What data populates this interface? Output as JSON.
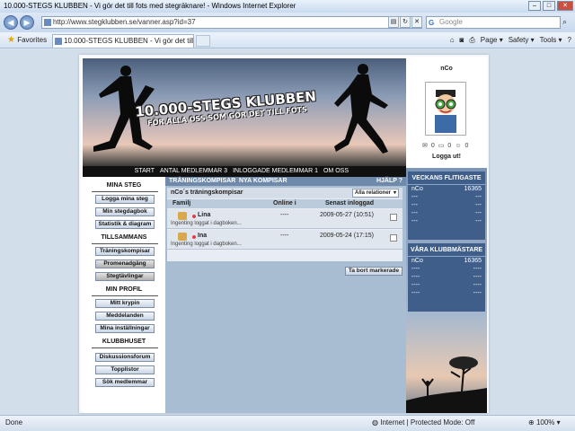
{
  "browser": {
    "title": "10.000-STEGS KLUBBEN - Vi gör det till fots med stegräknare! - Windows Internet Explorer",
    "url": "http://www.stegklubben.se/vanner.asp?id=37",
    "search_placeholder": "Google",
    "favorites_label": "Favorites",
    "tab_title": "10.000-STEGS KLUBBEN - Vi gör det till fots med s...",
    "cmd": {
      "page": "Page ▾",
      "safety": "Safety ▾",
      "tools": "Tools ▾",
      "help": "?"
    },
    "status_done": "Done",
    "status_zone": "Internet | Protected Mode: Off",
    "zoom": "100%"
  },
  "banner": {
    "title": "10.000-STEGS KLUBBEN",
    "subtitle": "FÖR ALLA OSS SOM GÖR DET TILL FOTS"
  },
  "topnav": {
    "start": "START",
    "members": "ANTAL MEDLEMMAR 3",
    "logged": "INLOGGADE MEDLEMMAR 1",
    "about": "OM OSS"
  },
  "profile": {
    "name": "nCo",
    "mail_count": "0",
    "msg_count": "0",
    "friend_count": "0",
    "logout": "Logga ut!"
  },
  "menu": {
    "s1": "MINA STEG",
    "log_steps": "Logga mina steg",
    "step_diary": "Min stegdagbok",
    "stats": "Statistik & diagram",
    "s2": "TILLSAMMANS",
    "training_pals": "Träningskompisar",
    "walking_club": "Promenadgäng",
    "step_contests": "Stegtävlingar",
    "s3": "MIN PROFIL",
    "my_den": "Mitt krypin",
    "messages": "Meddelanden",
    "settings": "Mina inställningar",
    "s4": "KLUBBHUSET",
    "forum": "Diskussionsforum",
    "toplists": "Topplistor",
    "search_members": "Sök medlemmar"
  },
  "main": {
    "tab_active": "TRÄNINGSKOMPISAR",
    "tab_new": "NYA KOMPISAR",
    "help": "HJÄLP",
    "panel_title": "nCo´s träningskompisar",
    "filter": "Alla relationer",
    "col_family": "Familj",
    "col_online": "Online i",
    "col_last": "Senast inloggad",
    "friends": [
      {
        "name": "Lina",
        "online": "----",
        "last": "2009-05-27 (10:51)",
        "note": "Ingenting loggat i dagboken..."
      },
      {
        "name": "Ina",
        "online": "----",
        "last": "2009-05-24 (17:15)",
        "note": "Ingenting loggat i dagboken..."
      }
    ],
    "delete_button": "Ta bort markerade"
  },
  "weekly": {
    "title": "VECKANS FLITIGASTE",
    "rows": [
      {
        "name": "nCo",
        "value": "16365"
      },
      {
        "name": "---",
        "value": "---"
      },
      {
        "name": "---",
        "value": "---"
      },
      {
        "name": "---",
        "value": "---"
      },
      {
        "name": "---",
        "value": "---"
      }
    ]
  },
  "champions": {
    "title": "VÅRA KLUBBMÄSTARE",
    "rows": [
      {
        "name": "nCo",
        "value": "16365"
      },
      {
        "name": "----",
        "value": "----"
      },
      {
        "name": "----",
        "value": "----"
      },
      {
        "name": "----",
        "value": "----"
      },
      {
        "name": "----",
        "value": "----"
      }
    ]
  }
}
